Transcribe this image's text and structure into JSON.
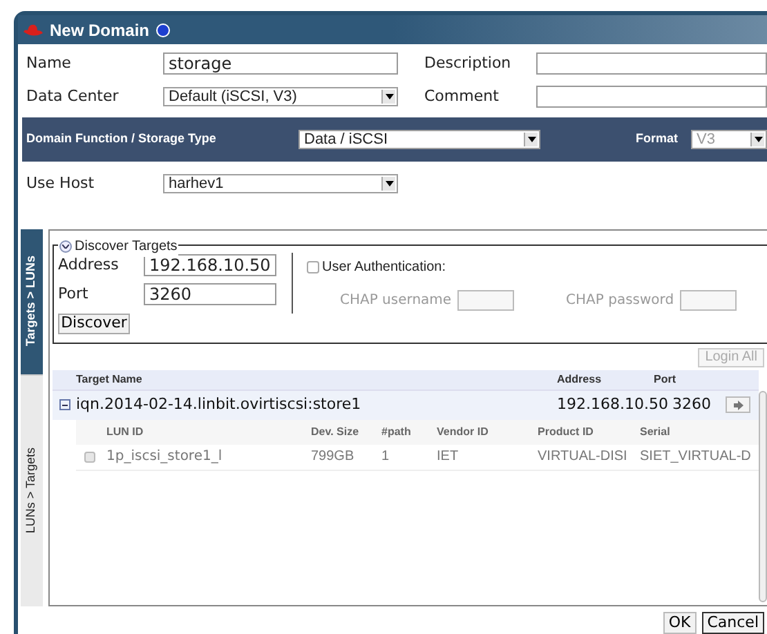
{
  "window": {
    "title": "New Domain"
  },
  "name": {
    "label": "Name",
    "value": "storage"
  },
  "description": {
    "label": "Description"
  },
  "data_center": {
    "label": "Data Center",
    "value": "Default (iSCSI, V3)"
  },
  "comment": {
    "label": "Comment"
  },
  "domain_function": {
    "label": "Domain Function / Storage Type",
    "value": "Data / iSCSI"
  },
  "format": {
    "label": "Format",
    "value": "V3",
    "disabled": true
  },
  "use_host": {
    "label": "Use Host",
    "value": "harhev1"
  },
  "side_tabs": [
    {
      "label": "Targets > LUNs",
      "selected": true
    },
    {
      "label": "LUNs > Targets",
      "selected": false
    }
  ],
  "discover": {
    "title": "Discover Targets",
    "expanded": true,
    "address": {
      "label": "Address",
      "value": "192.168.10.50"
    },
    "port": {
      "label": "Port",
      "value": "3260"
    },
    "button": "Discover",
    "user_auth": {
      "label": "User Authentication:",
      "checked": false
    },
    "chap_username": {
      "label": "CHAP username",
      "disabled": true
    },
    "chap_password": {
      "label": "CHAP password",
      "disabled": true
    }
  },
  "login_all": {
    "label": "Login All",
    "disabled": true
  },
  "targets": {
    "columns": [
      "Target Name",
      "Address",
      "Port"
    ],
    "rows": [
      {
        "name": "iqn.2014-02-14.linbit.ovirtiscsi:store1",
        "address": "192.168.10.50",
        "port": "3260",
        "expanded": true,
        "luns": {
          "columns": [
            "LUN ID",
            "Dev. Size",
            "#path",
            "Vendor ID",
            "Product ID",
            "Serial"
          ],
          "rows": [
            {
              "checked": false,
              "cells": [
                "1p_iscsi_store1_l",
                "799GB",
                "1",
                "IET",
                "VIRTUAL-DISI",
                "SIET_VIRTUAL-D"
              ]
            }
          ]
        }
      }
    ]
  },
  "buttons": [
    "OK",
    "Cancel"
  ]
}
